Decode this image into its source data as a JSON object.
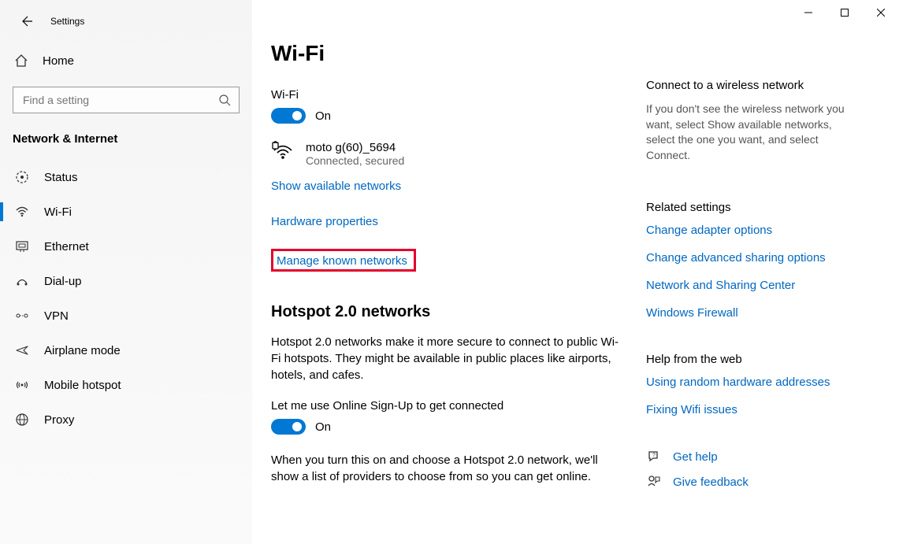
{
  "window": {
    "title": "Settings"
  },
  "sidebar": {
    "home": "Home",
    "search_placeholder": "Find a setting",
    "section": "Network & Internet",
    "items": [
      {
        "label": "Status"
      },
      {
        "label": "Wi-Fi"
      },
      {
        "label": "Ethernet"
      },
      {
        "label": "Dial-up"
      },
      {
        "label": "VPN"
      },
      {
        "label": "Airplane mode"
      },
      {
        "label": "Mobile hotspot"
      },
      {
        "label": "Proxy"
      }
    ]
  },
  "main": {
    "title": "Wi-Fi",
    "wifi_label": "Wi-Fi",
    "wifi_state": "On",
    "network_name": "moto g(60)_5694",
    "network_status": "Connected, secured",
    "links": {
      "show_available": "Show available networks",
      "hardware_props": "Hardware properties",
      "manage_known": "Manage known networks"
    },
    "hotspot_title": "Hotspot 2.0 networks",
    "hotspot_desc": "Hotspot 2.0 networks make it more secure to connect to public Wi-Fi hotspots. They might be available in public places like airports, hotels, and cafes.",
    "signup_label": "Let me use Online Sign-Up to get connected",
    "signup_state": "On",
    "signup_desc": "When you turn this on and choose a Hotspot 2.0 network, we'll show a list of providers to choose from so you can get online."
  },
  "rail": {
    "connect_title": "Connect to a wireless network",
    "connect_desc": "If you don't see the wireless network you want, select Show available networks, select the one you want, and select Connect.",
    "related_title": "Related settings",
    "related_links": [
      "Change adapter options",
      "Change advanced sharing options",
      "Network and Sharing Center",
      "Windows Firewall"
    ],
    "help_title": "Help from the web",
    "help_links": [
      "Using random hardware addresses",
      "Fixing Wifi issues"
    ],
    "get_help": "Get help",
    "give_feedback": "Give feedback"
  }
}
